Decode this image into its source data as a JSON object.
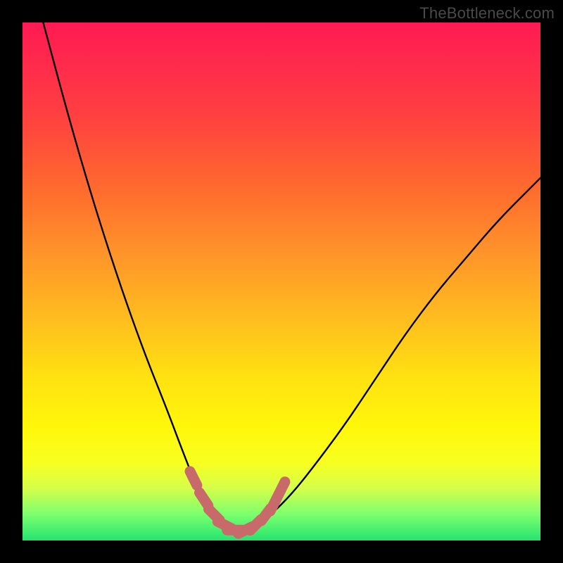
{
  "watermark": "TheBottleneck.com",
  "chart_data": {
    "type": "line",
    "title": "",
    "xlabel": "",
    "ylabel": "",
    "xlim": [
      0,
      100
    ],
    "ylim": [
      0,
      100
    ],
    "series": [
      {
        "name": "bottleneck-curve",
        "x": [
          4,
          8,
          12,
          16,
          20,
          24,
          28,
          31,
          33,
          35,
          37,
          39,
          41,
          43,
          45,
          48,
          52,
          56,
          62,
          68,
          74,
          80,
          86,
          92,
          98,
          100
        ],
        "values": [
          100,
          85,
          71,
          58,
          46,
          35,
          25,
          17,
          12,
          8,
          5,
          3,
          2,
          2,
          3,
          5,
          9,
          14,
          22,
          31,
          40,
          48,
          55,
          62,
          68,
          70
        ]
      }
    ],
    "markers": {
      "name": "highlight-segment",
      "color": "#c96a6a",
      "points": [
        {
          "x": 33,
          "y": 12
        },
        {
          "x": 35,
          "y": 8
        },
        {
          "x": 37,
          "y": 5
        },
        {
          "x": 39,
          "y": 3
        },
        {
          "x": 41,
          "y": 2
        },
        {
          "x": 43,
          "y": 2
        },
        {
          "x": 45,
          "y": 3
        },
        {
          "x": 47,
          "y": 5
        },
        {
          "x": 48.5,
          "y": 7
        },
        {
          "x": 50,
          "y": 10
        }
      ]
    }
  },
  "colors": {
    "curve": "#000000",
    "marker": "#c96a6a",
    "background_top": "#ff1a53",
    "background_bottom": "#23e56e"
  }
}
